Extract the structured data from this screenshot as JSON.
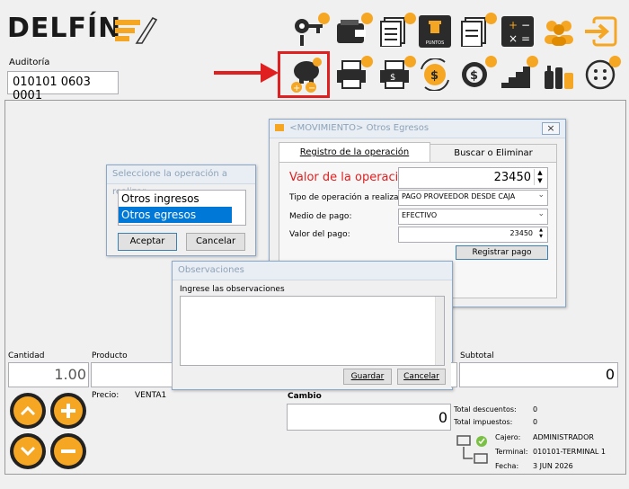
{
  "app": {
    "logo_text": "DELFÍN"
  },
  "audit": {
    "label": "Auditoría",
    "value": "010101 0603 0001"
  },
  "toolbar": {
    "puntos_label": "PUNTOS"
  },
  "op_dialog": {
    "title": "Seleccione la operación a realizar",
    "options": [
      "Otros ingresos",
      "Otros egresos"
    ],
    "accept": "Aceptar",
    "cancel": "Cancelar"
  },
  "mov_dialog": {
    "title": "<MOVIMIENTO> Otros Egresos",
    "tabs": [
      "Registro de la operación",
      "Buscar o Eliminar"
    ],
    "value_label": "Valor de la operación:",
    "value": "23450",
    "type_label": "Tipo de operación a realizar:",
    "type_value": "PAGO PROVEEDOR DESDE CAJA",
    "medium_label": "Medio de pago:",
    "medium_value": "EFECTIVO",
    "payment_label": "Valor del pago:",
    "payment_value": "23450",
    "register": "Registrar pago",
    "close": "×"
  },
  "obs_dialog": {
    "title": "Observaciones",
    "prompt": "Ingrese las observaciones",
    "save": "Guardar",
    "cancel": "Cancelar"
  },
  "bottom": {
    "cantidad_label": "Cantidad",
    "cantidad_value": "1.00",
    "producto_label": "Producto",
    "precio_label": "Precio:",
    "precio_value": "VENTA1",
    "subtotal_label": "Subtotal",
    "subtotal_value": "0",
    "cambio_label": "Cambio",
    "cambio_value": "0",
    "descuentos_label": "Total descuentos:",
    "descuentos_value": "0",
    "impuestos_label": "Total impuestos:",
    "impuestos_value": "0",
    "cajero_label": "Cajero:",
    "cajero_value": "ADMINISTRADOR",
    "terminal_label": "Terminal:",
    "terminal_value": "010101-TERMINAL 1",
    "fecha_label": "Fecha:",
    "fecha_value": "3 JUN 2026"
  },
  "colors": {
    "accent": "#f5a623",
    "highlight_red": "#e02020",
    "selection": "#0078d7"
  }
}
